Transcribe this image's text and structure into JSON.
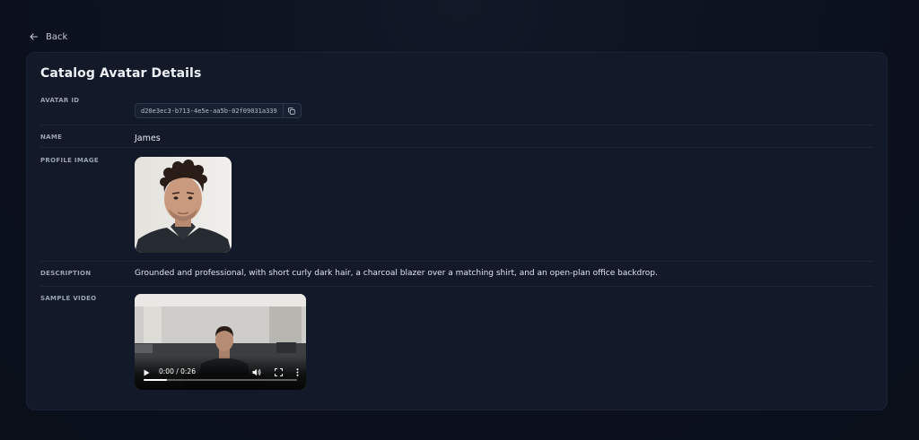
{
  "nav": {
    "back_label": "Back"
  },
  "page": {
    "title": "Catalog Avatar Details"
  },
  "fields": {
    "avatar_id": {
      "label": "AVATAR ID",
      "value": "d20e3ec3-b713-4e5e-aa5b-02f09031a339"
    },
    "name": {
      "label": "NAME",
      "value": "James"
    },
    "profile_image": {
      "label": "PROFILE IMAGE"
    },
    "description": {
      "label": "DESCRIPTION",
      "value": "Grounded and professional, with short curly dark hair, a charcoal blazer over a matching shirt, and an open-plan office backdrop."
    },
    "sample_video": {
      "label": "SAMPLE VIDEO",
      "time_display": "0:00 / 0:26",
      "progress_fraction": 0.15
    }
  },
  "icons": {
    "back": "arrow-left-icon",
    "copy": "copy-icon",
    "play": "play-icon",
    "volume": "volume-icon",
    "fullscreen": "fullscreen-icon",
    "more": "more-vertical-icon"
  },
  "colors": {
    "background": "#0b111d",
    "card": "#121a2a",
    "label": "#9aa3b2",
    "text": "#e5e9f0"
  }
}
